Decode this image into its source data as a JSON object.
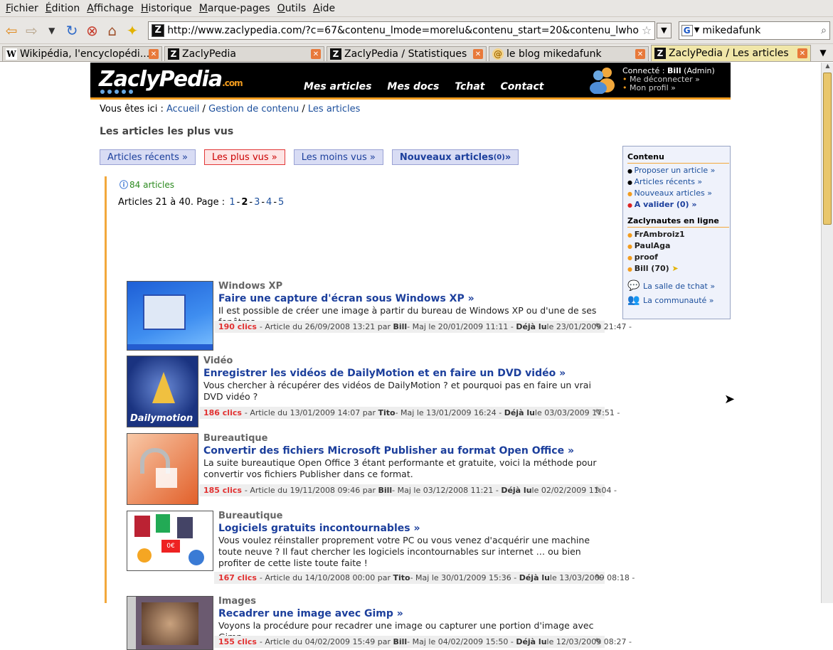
{
  "menu": [
    "Fichier",
    "Édition",
    "Affichage",
    "Historique",
    "Marque-pages",
    "Outils",
    "Aide"
  ],
  "url": "http://www.zaclypedia.com/?c=67&contenu_lmode=morelu&contenu_start=20&contenu_lwho",
  "search_value": "mikedafunk",
  "tabs": [
    {
      "icon": "W",
      "label": "Wikipédia, l'encyclopédi...",
      "active": false
    },
    {
      "icon": "Z",
      "label": "ZaclyPedia",
      "active": false
    },
    {
      "icon": "Z",
      "label": "ZaclyPedia / Statistiques",
      "active": false
    },
    {
      "icon": "@",
      "label": "le blog mikedafunk",
      "active": false
    },
    {
      "icon": "Z",
      "label": "ZaclyPedia / Les articles",
      "active": true
    }
  ],
  "site": {
    "logo": "ZaclyPedia",
    "logo_suffix": ".com",
    "nav": [
      "Mes articles",
      "Mes docs",
      "Tchat",
      "Contact"
    ],
    "user": {
      "prefix": "Connecté : ",
      "name": "Bill",
      "role": " (Admin)",
      "logout": "Me déconnecter »",
      "profile": "Mon profil »"
    }
  },
  "breadcrumb": {
    "prefix": "Vous êtes ici : ",
    "items": [
      "Accueil",
      "Gestion de contenu",
      "Les articles"
    ],
    "sep": " / "
  },
  "page_title": "Les articles les plus vus",
  "filters": [
    {
      "label": "Articles récents »"
    },
    {
      "label": "Les plus vus »"
    },
    {
      "label": "Les moins vus »"
    },
    {
      "label": "Nouveaux articles",
      "extra": " (0)",
      "suffix": " »"
    }
  ],
  "count_text": "84 articles",
  "pagination": {
    "prefix": "Articles 21 à 40. Page :",
    "pages": [
      "1",
      "2",
      "3",
      "4",
      "5"
    ],
    "current": "2"
  },
  "articles": [
    {
      "category": "Windows XP",
      "title": "Faire une capture d'écran sous Windows XP  »",
      "desc": "Il est possible de créer une image à partir du bureau de Windows XP ou d'une de ses fenêtres.",
      "clicks": "190 clics",
      "meta1": " - Article du 26/09/2008 13:21 par ",
      "author": "Bill",
      "meta2": " - Maj le 20/01/2009 11:11 - ",
      "read": "Déjà lu",
      "meta3": " le 23/01/2009 21:47 -"
    },
    {
      "category": "Vidéo",
      "title": "Enregistrer les vidéos de DailyMotion et en faire un DVD vidéo »",
      "desc": "Vous chercher à récupérer des vidéos de DailyMotion ? et pourquoi pas en faire un vrai DVD vidéo ?",
      "clicks": "186 clics",
      "meta1": " - Article du 13/01/2009 14:07 par ",
      "author": "Tito",
      "meta2": " - Maj le 13/01/2009 16:24 - ",
      "read": "Déjà lu",
      "meta3": " le 03/03/2009 17:51 -"
    },
    {
      "category": "Bureautique",
      "title": "Convertir des fichiers Microsoft Publisher au format Open Office »",
      "desc": "La suite bureautique Open Office 3 étant performante et gratuite, voici la méthode pour convertir vos fichiers Publisher dans ce format.",
      "clicks": "185 clics",
      "meta1": " - Article du 19/11/2008 09:46 par ",
      "author": "Bill",
      "meta2": " - Maj le 03/12/2008 11:21 - ",
      "read": "Déjà lu",
      "meta3": " le 02/02/2009 11:04 -"
    },
    {
      "category": "Bureautique",
      "title": "Logiciels gratuits incontournables »",
      "desc": "Vous voulez réinstaller proprement votre PC ou vous venez d'acquérir une machine toute neuve ? Il faut chercher les logiciels incontournables sur internet … ou bien profiter de cette liste toute faite !",
      "clicks": "167 clics",
      "meta1": " - Article du 14/10/2008 00:00 par ",
      "author": "Tito",
      "meta2": " - Maj le 30/01/2009 15:36 - ",
      "read": "Déjà lu",
      "meta3": " le 13/03/2009 08:18 -"
    },
    {
      "category": "Images",
      "title": "Recadrer une image avec Gimp »",
      "desc": "Voyons la procédure pour recadrer une image ou capturer une portion d'image avec Gimp.",
      "clicks": "155 clics",
      "meta1": " - Article du 04/02/2009 15:49 par ",
      "author": "Bill",
      "meta2": " - Maj le 04/02/2009 15:50 - ",
      "read": "Déjà lu",
      "meta3": " le 12/03/2009 08:27 -"
    }
  ],
  "thumb_labels": {
    "dailymotion": "Dailymotion"
  },
  "sidebar": {
    "contenu_title": "Contenu",
    "links": [
      "Proposer un article »",
      "Articles récents »",
      "Nouveaux articles »"
    ],
    "validate": "A valider (0) »",
    "online_title": "Zaclynautes en ligne",
    "users": [
      "FrAmbroiz1",
      "PaulAga",
      "proof",
      "Bill (70)"
    ],
    "chat": "La salle de tchat »",
    "community": "La communauté »"
  }
}
